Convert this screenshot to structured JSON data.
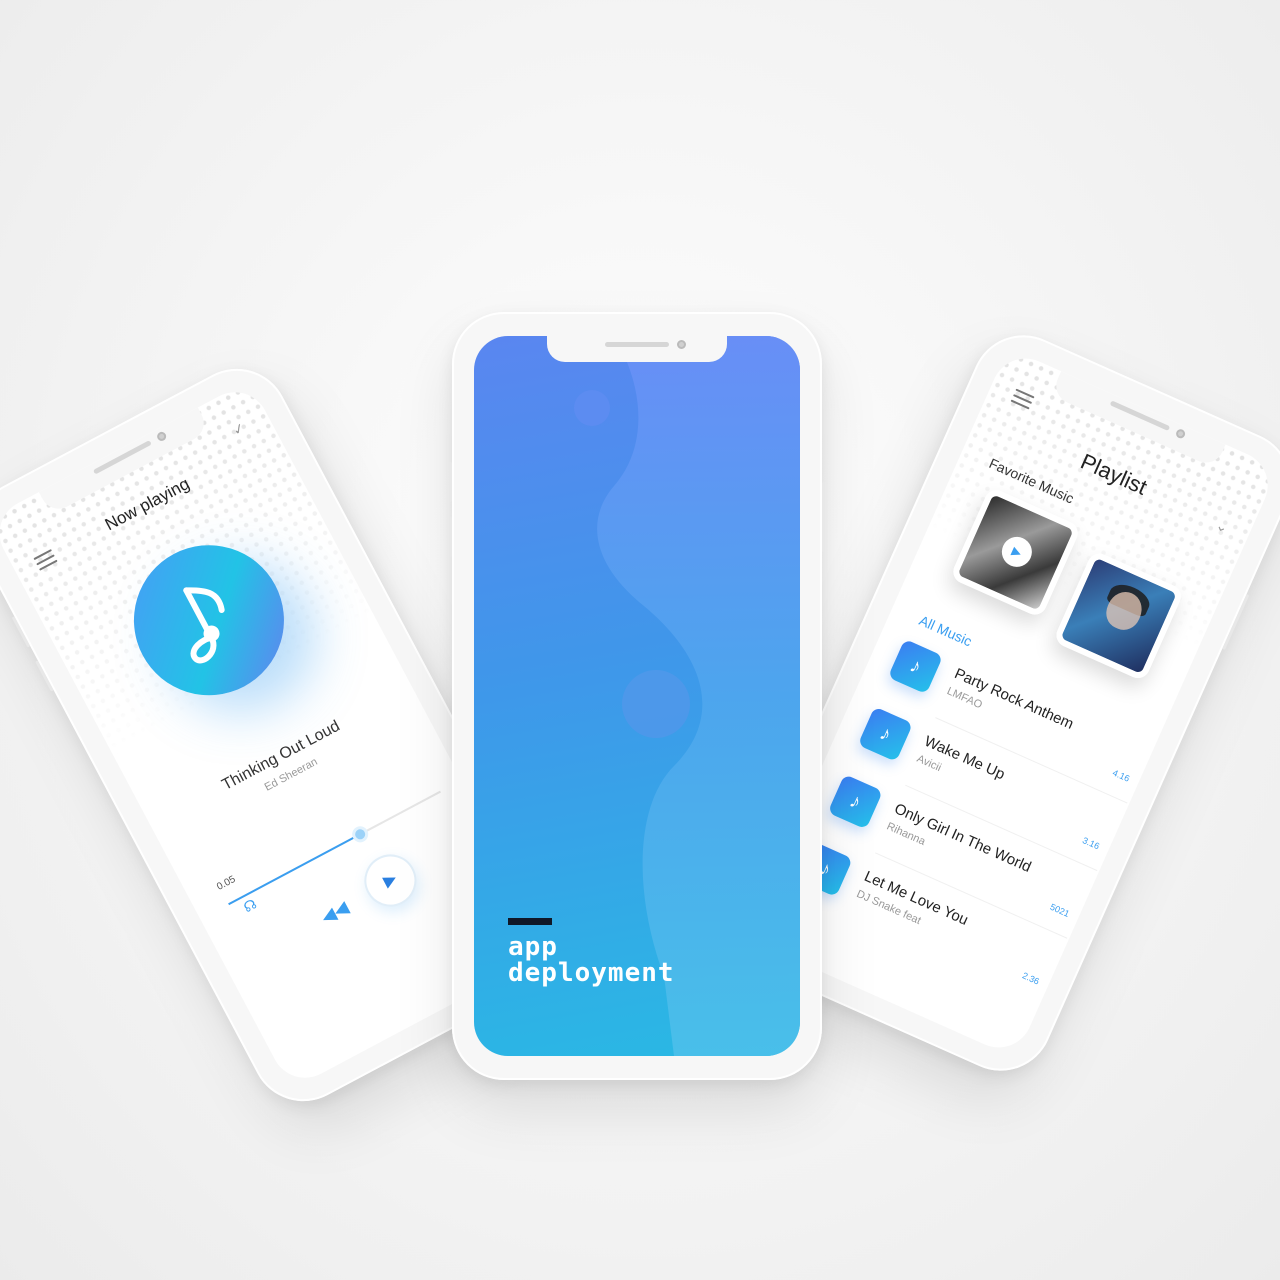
{
  "left_phone": {
    "title": "Now playing",
    "song": "Thinking Out Loud",
    "artist": "Ed Sheeran",
    "elapsed": "0.05",
    "progress": 0.62,
    "icons": {
      "menu": "menu-icon",
      "check": "check-icon",
      "note": "music-note-icon",
      "rewind": "rewind-icon",
      "play": "play-icon",
      "headphones": "headphones-icon"
    },
    "accent": "#3a9ef0"
  },
  "center_phone": {
    "brand_line1": "app",
    "brand_line2": "deployment",
    "gradient": [
      "#5a86f0",
      "#3f97ea",
      "#29b9e4"
    ]
  },
  "right_phone": {
    "title": "Playlist",
    "favorite_label": "Favorite Music",
    "all_label": "All Music",
    "tracks": [
      {
        "title": "Party Rock Anthem",
        "artist": "LMFAO",
        "duration": "4.16"
      },
      {
        "title": "Wake Me Up",
        "artist": "Avicii",
        "duration": "3.16"
      },
      {
        "title": "Only Girl In The World",
        "artist": "Rihanna",
        "duration": "5021"
      },
      {
        "title": "Let Me Love You",
        "artist": "DJ Snake feat",
        "duration": "2.36"
      }
    ],
    "icons": {
      "menu": "menu-icon",
      "chevron": "chevron-down-icon",
      "album_play": "play-icon",
      "track": "music-note-icon"
    }
  }
}
